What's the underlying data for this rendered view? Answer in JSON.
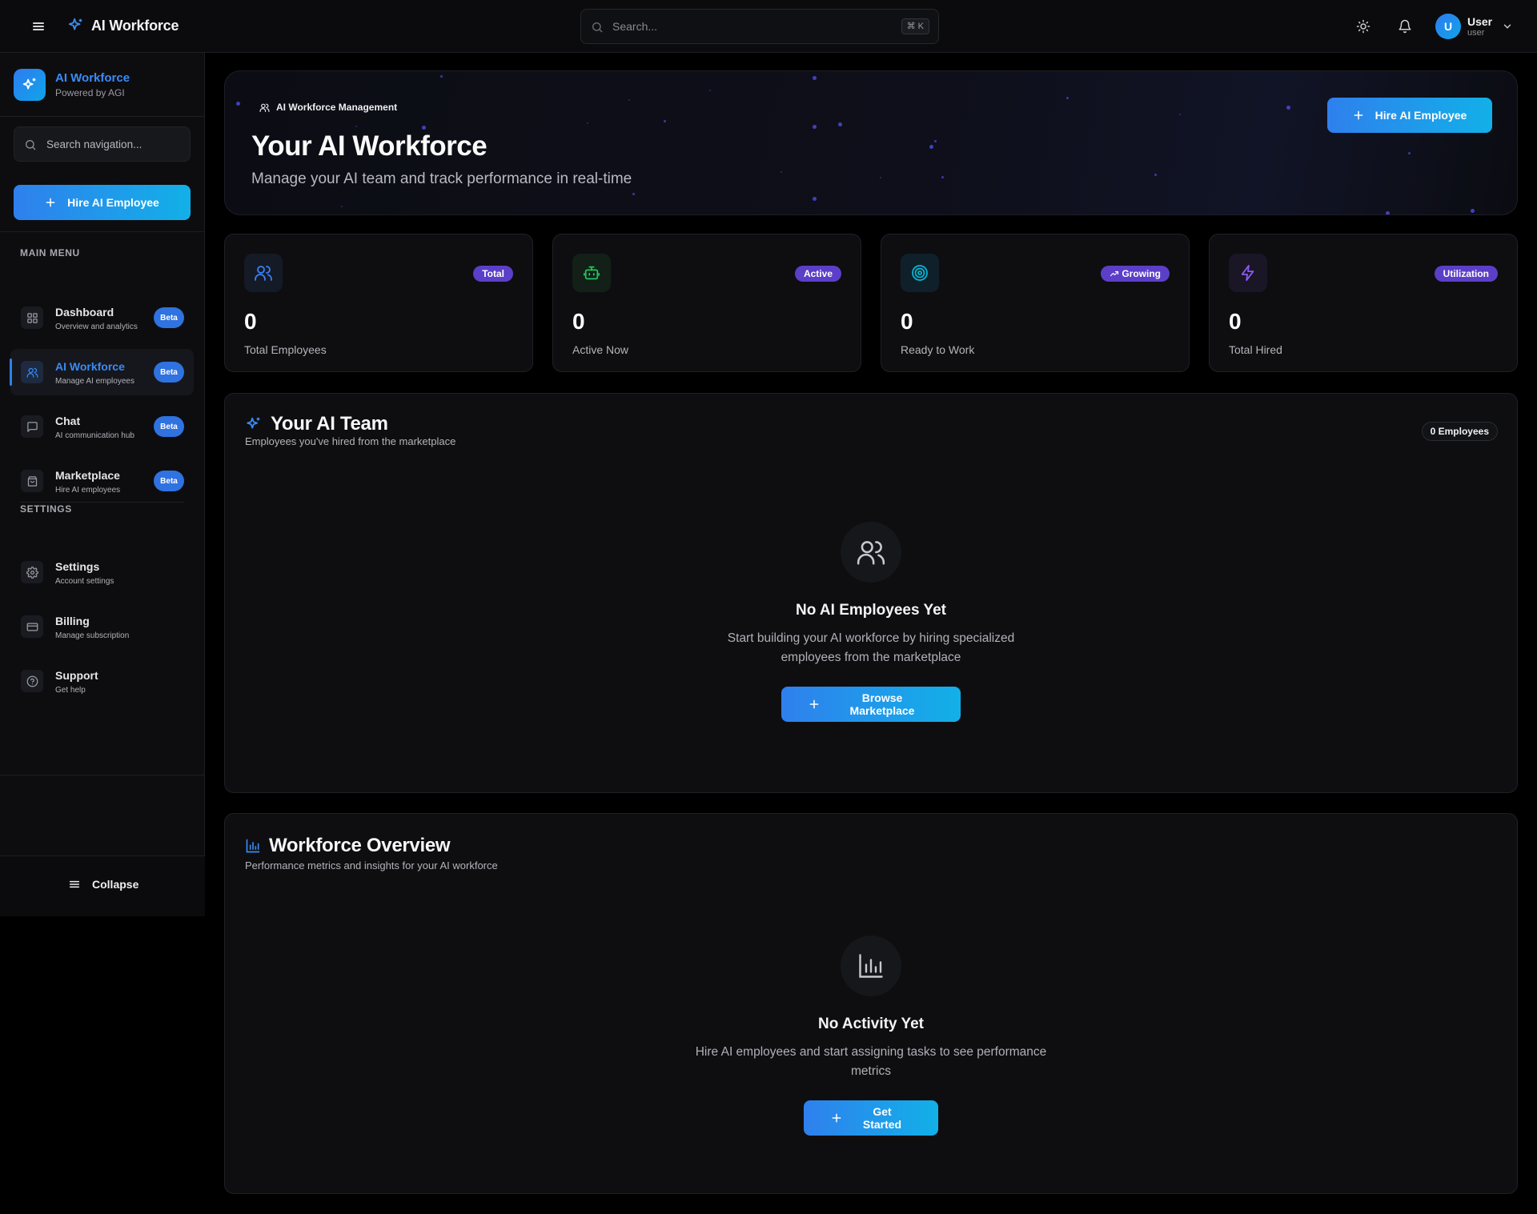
{
  "topbar": {
    "brand": "AI Workforce",
    "search_placeholder": "Search...",
    "search_shortcut": "⌘ K",
    "user": {
      "initial": "U",
      "name": "User",
      "role": "user"
    }
  },
  "sidebar": {
    "brand_title": "AI Workforce",
    "brand_sub": "Powered by AGI",
    "search_placeholder": "Search navigation...",
    "hire_label": "Hire AI Employee",
    "main_menu_label": "MAIN MENU",
    "main_items": [
      {
        "label": "Dashboard",
        "sub": "Overview and analytics",
        "badge": "Beta",
        "icon": "grid-icon",
        "active": false
      },
      {
        "label": "AI Workforce",
        "sub": "Manage AI employees",
        "badge": "Beta",
        "icon": "users-icon",
        "active": true
      },
      {
        "label": "Chat",
        "sub": "AI communication hub",
        "badge": "Beta",
        "icon": "message-icon",
        "active": false
      },
      {
        "label": "Marketplace",
        "sub": "Hire AI employees",
        "badge": "Beta",
        "icon": "shopping-bag-icon",
        "active": false
      }
    ],
    "settings_label": "SETTINGS",
    "settings_items": [
      {
        "label": "Settings",
        "sub": "Account settings",
        "icon": "gear-icon"
      },
      {
        "label": "Billing",
        "sub": "Manage subscription",
        "icon": "credit-card-icon"
      },
      {
        "label": "Support",
        "sub": "Get help",
        "icon": "help-circle-icon"
      }
    ],
    "collapse_label": "Collapse"
  },
  "hero": {
    "kicker": "AI Workforce Management",
    "title": "Your AI Workforce",
    "subtitle": "Manage your AI team and track performance in real-time",
    "button": "Hire AI Employee"
  },
  "stats": [
    {
      "tag": "Total",
      "value": "0",
      "label": "Total Employees",
      "icon": "users-icon",
      "icon_color": "#3b82f6"
    },
    {
      "tag": "Active",
      "value": "0",
      "label": "Active Now",
      "icon": "bot-icon",
      "icon_color": "#22c55e"
    },
    {
      "tag": "Growing",
      "value": "0",
      "label": "Ready to Work",
      "icon": "target-icon",
      "icon_color": "#06b6d4"
    },
    {
      "tag": "Utilization",
      "value": "0",
      "label": "Total Hired",
      "icon": "zap-icon",
      "icon_color": "#8b5cf6"
    }
  ],
  "team": {
    "title": "Your AI Team",
    "subtitle": "Employees you've hired from the marketplace",
    "count": "0 Employees",
    "empty_title": "No AI Employees Yet",
    "empty_desc": "Start building your AI workforce by hiring specialized employees from the marketplace",
    "button": "Browse Marketplace"
  },
  "overview": {
    "title": "Workforce Overview",
    "subtitle": "Performance metrics and insights for your AI workforce",
    "empty_title": "No Activity Yet",
    "empty_desc": "Hire AI employees and start assigning tasks to see performance metrics",
    "button": "Get Started"
  },
  "colors": {
    "accent": "#2f80ed",
    "accent_2": "#12b0e8",
    "tag_purple": "#5b3fc8",
    "beta_badge": "#2f72e0"
  }
}
